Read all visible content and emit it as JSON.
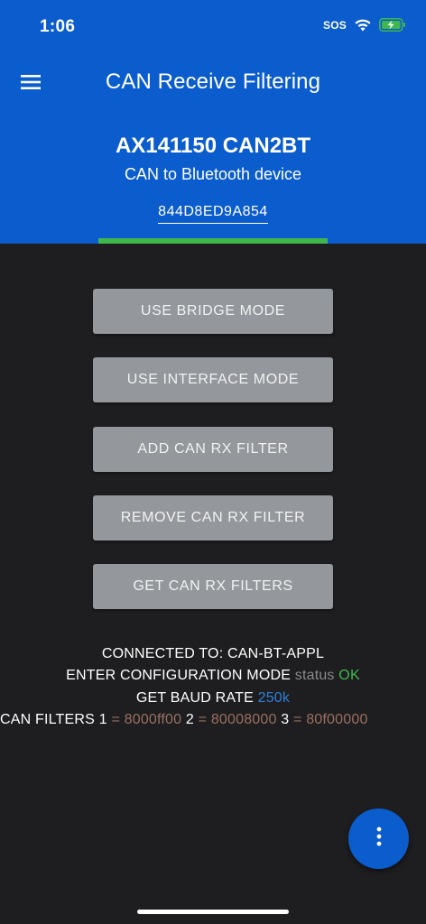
{
  "status_bar": {
    "time": "1:06",
    "sos": "SOS",
    "icons": [
      "wifi-icon",
      "battery-charging-icon"
    ],
    "battery_color": "#3fb74c"
  },
  "header": {
    "title": "CAN Receive Filtering",
    "menu_icon": "hamburger-menu-icon",
    "background_color": "#0b5ccc"
  },
  "device": {
    "name": "AX141150 CAN2BT",
    "description": "CAN to Bluetooth device",
    "mac": "844D8ED9A854",
    "connection_color": "#3fb74c"
  },
  "buttons": {
    "bridge_mode": "USE BRIDGE MODE",
    "interface_mode": "USE INTERFACE MODE",
    "add_filter": "ADD CAN RX FILTER",
    "remove_filter": "REMOVE CAN RX FILTER",
    "get_filters": "GET CAN RX FILTERS"
  },
  "info": {
    "connected_label": "CONNECTED TO: ",
    "connected_value": "CAN-BT-APPL",
    "config_label": "ENTER CONFIGURATION MODE ",
    "config_status_label": "status ",
    "config_status_value": "OK",
    "baud_label": "GET BAUD RATE ",
    "baud_value": "250k",
    "filters_label": "CAN FILTERS ",
    "filters": [
      {
        "index": "1",
        "value": " = 8000ff00 "
      },
      {
        "index": "2",
        "value": " = 80008000 "
      },
      {
        "index": "3",
        "value": " = 80f00000"
      }
    ]
  },
  "fab": {
    "icon": "more-vertical-icon"
  }
}
